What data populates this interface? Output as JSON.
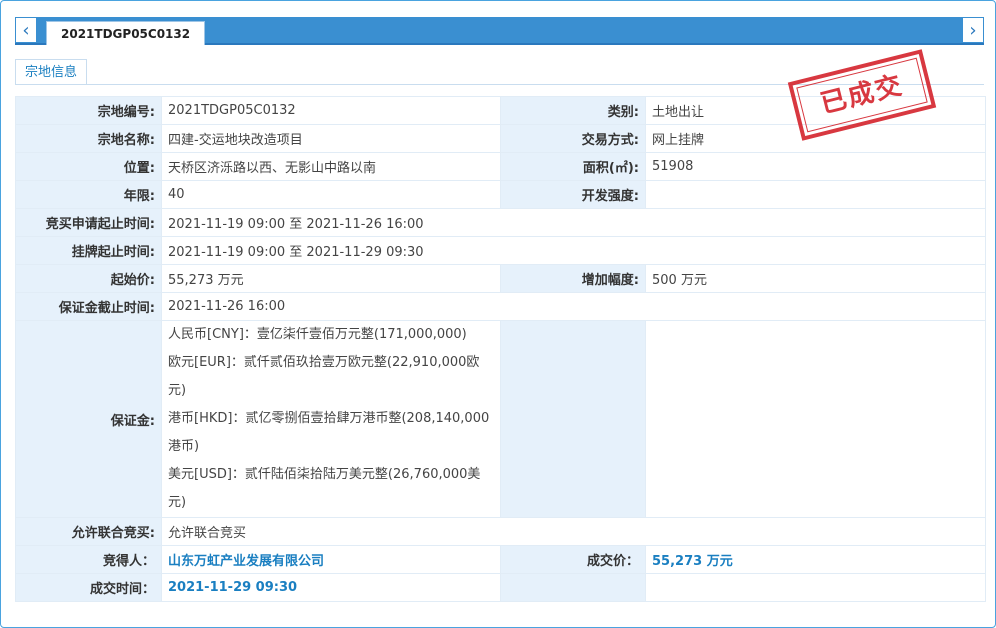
{
  "tab": {
    "title": "2021TDGP05C0132"
  },
  "subtab": {
    "label": "宗地信息"
  },
  "stamp": {
    "text": "已成交",
    "color": "#d4232c"
  },
  "nav": {
    "prev_icon": "chevron-left-icon",
    "next_icon": "chevron-right-icon"
  },
  "fields": {
    "parcel_no": {
      "label": "宗地编号:",
      "value": "2021TDGP05C0132"
    },
    "category": {
      "label": "类别:",
      "value": "土地出让"
    },
    "parcel_name": {
      "label": "宗地名称:",
      "value": "四建-交运地块改造项目"
    },
    "trade_mode": {
      "label": "交易方式:",
      "value": "网上挂牌"
    },
    "location": {
      "label": "位置:",
      "value": "天桥区济泺路以西、无影山中路以南"
    },
    "area": {
      "label": "面积(㎡):",
      "value": "51908"
    },
    "term": {
      "label": "年限:",
      "value": "40"
    },
    "intensity": {
      "label": "开发强度:",
      "value": ""
    },
    "bid_apply_period": {
      "label": "竞买申请起止时间:",
      "value": "2021-11-19 09:00 至 2021-11-26 16:00"
    },
    "listing_period": {
      "label": "挂牌起止时间:",
      "value": "2021-11-19 09:00 至 2021-11-29 09:30"
    },
    "start_price": {
      "label": "起始价:",
      "value": "55,273 万元"
    },
    "increment": {
      "label": "增加幅度:",
      "value": "500 万元"
    },
    "deposit_deadline": {
      "label": "保证金截止时间:",
      "value": "2021-11-26 16:00"
    },
    "deposit": {
      "label": "保证金:",
      "lines": [
        "人民币[CNY]：壹亿柒仟壹佰万元整(171,000,000)",
        "欧元[EUR]：贰仟贰佰玖拾壹万欧元整(22,910,000欧",
        "元)",
        "港币[HKD]：贰亿零捌佰壹拾肆万港币整(208,140,000",
        "港币)",
        "美元[USD]：贰仟陆佰柒拾陆万美元整(26,760,000美",
        "元)"
      ]
    },
    "joint_bid": {
      "label": "允许联合竞买:",
      "value": "允许联合竞买"
    },
    "winner": {
      "label": "竞得人：",
      "value": "山东万虹产业发展有限公司"
    },
    "deal_price": {
      "label": "成交价：",
      "value": "55,273 万元"
    },
    "deal_time": {
      "label": "成交时间：",
      "value": "2021-11-29 09:30"
    }
  }
}
